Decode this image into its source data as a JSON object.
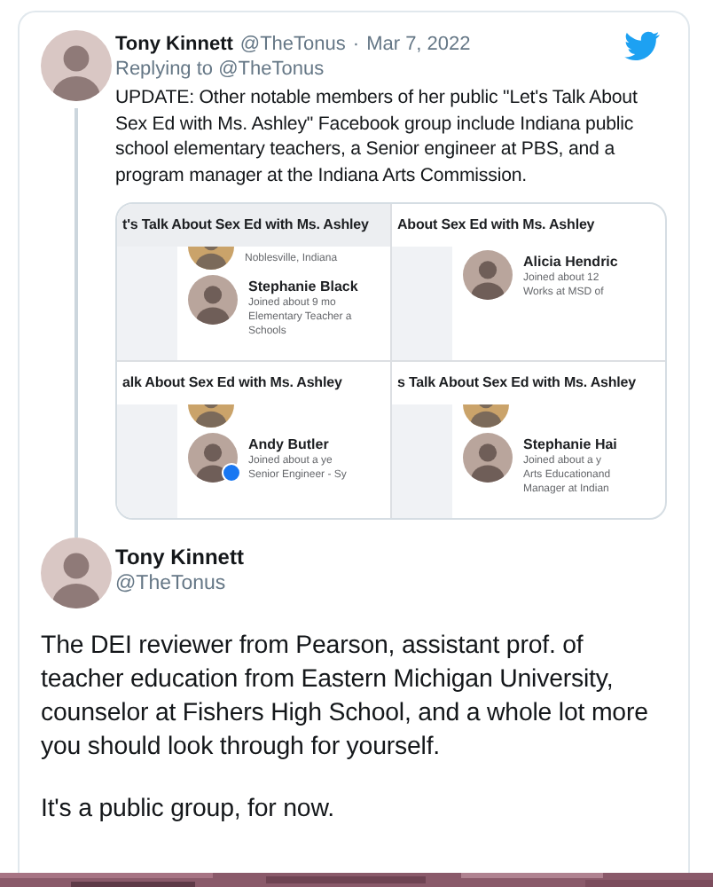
{
  "quoted_tweet": {
    "name": "Tony Kinnett",
    "handle": "@TheTonus",
    "separator": "·",
    "date": "Mar 7, 2022",
    "replying_to": "Replying to @TheTonus",
    "text": "UPDATE: Other notable members of her public \"Let's Talk About Sex Ed with Ms. Ashley\" Facebook group include Indiana public school elementary teachers, a Senior engineer at PBS, and a program manager at the Indiana Arts Commission.",
    "attached_image": {
      "panels": [
        {
          "header": "t's Talk About Sex Ed with Ms. Ashley",
          "header_shaded": true,
          "members": [
            {
              "kind": "partial",
              "lines": [
                "Noblesville, Indiana"
              ]
            },
            {
              "kind": "full",
              "name": "Stephanie Black",
              "lines": [
                "Joined about 9 mo",
                "Elementary Teacher a",
                "Schools"
              ],
              "badge": false
            }
          ]
        },
        {
          "header": "About Sex Ed with Ms. Ashley",
          "header_shaded": false,
          "members": [
            {
              "kind": "full",
              "name": "Alicia Hendric",
              "lines": [
                "Joined about 12",
                "Works at MSD of"
              ],
              "badge": false
            }
          ]
        },
        {
          "header": "alk About Sex Ed with Ms. Ashley",
          "header_shaded": false,
          "members": [
            {
              "kind": "partial"
            },
            {
              "kind": "full",
              "name": "Andy Butler",
              "lines": [
                "Joined about a ye",
                "Senior Engineer - Sy"
              ],
              "badge": true
            }
          ]
        },
        {
          "header": "s Talk About Sex Ed with Ms. Ashley",
          "header_shaded": false,
          "members": [
            {
              "kind": "partial"
            },
            {
              "kind": "full",
              "name": "Stephanie Hai",
              "lines": [
                "Joined about a y",
                "Arts Educationand",
                "Manager at Indian"
              ],
              "badge": false
            }
          ]
        }
      ]
    }
  },
  "tweet": {
    "name": "Tony Kinnett",
    "handle": "@TheTonus",
    "paragraphs": [
      "The DEI reviewer from Pearson, assistant prof. of teacher education from Eastern Michigan University, counselor at Fishers High School, and a whole lot more you should look through for yourself.",
      "It's a public group, for now."
    ]
  }
}
